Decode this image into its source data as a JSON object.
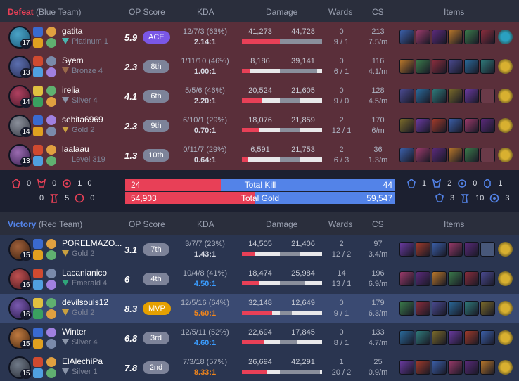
{
  "headers": {
    "op_score": "OP Score",
    "kda": "KDA",
    "damage": "Damage",
    "wards": "Wards",
    "cs": "CS",
    "items": "Items"
  },
  "blue_team": {
    "result": "Defeat",
    "label": "(Blue Team)",
    "result_color": "#e84057",
    "players": [
      {
        "name": "gatita",
        "rank": "Platinum 1",
        "level": "17",
        "op": "5.9",
        "badge": "ACE",
        "kda_detail": "12/7/3 (63%)",
        "kda_ratio": "2.14:1",
        "dmg_dealt": "41,273",
        "dmg_taken": "44,728",
        "dealt_frac": 0.92,
        "taken_frac": 1.0,
        "wards_placed": "0",
        "wards_detail": "9 / 1",
        "cs": "213",
        "cs_per_min": "7.5/m"
      },
      {
        "name": "Syem",
        "rank": "Bronze 4",
        "level": "13",
        "op": "2.3",
        "badge": "8th",
        "kda_detail": "1/11/10 (46%)",
        "kda_ratio": "1.00:1",
        "dmg_dealt": "8,186",
        "dmg_taken": "39,141",
        "dealt_frac": 0.18,
        "taken_frac": 0.88,
        "wards_placed": "0",
        "wards_detail": "6 / 1",
        "cs": "116",
        "cs_per_min": "4.1/m"
      },
      {
        "name": "irelia",
        "rank": "Silver 4",
        "level": "14",
        "op": "4.1",
        "badge": "6th",
        "kda_detail": "5/5/6 (46%)",
        "kda_ratio": "2.20:1",
        "dmg_dealt": "20,524",
        "dmg_taken": "21,605",
        "dealt_frac": 0.46,
        "taken_frac": 0.48,
        "wards_placed": "0",
        "wards_detail": "9 / 0",
        "cs": "128",
        "cs_per_min": "4.5/m"
      },
      {
        "name": "sebita6969",
        "rank": "Gold 2",
        "level": "14",
        "op": "2.3",
        "badge": "9th",
        "kda_detail": "6/10/1 (29%)",
        "kda_ratio": "0.70:1",
        "dmg_dealt": "18,076",
        "dmg_taken": "21,859",
        "dealt_frac": 0.4,
        "taken_frac": 0.49,
        "wards_placed": "2",
        "wards_detail": "12 / 1",
        "cs": "170",
        "cs_per_min": "6/m"
      },
      {
        "name": "laalaau",
        "rank": "Level 319",
        "level": "13",
        "op": "1.3",
        "badge": "10th",
        "kda_detail": "0/11/7 (29%)",
        "kda_ratio": "0.64:1",
        "dmg_dealt": "6,591",
        "dmg_taken": "21,753",
        "dealt_frac": 0.15,
        "taken_frac": 0.49,
        "wards_placed": "2",
        "wards_detail": "6 / 3",
        "cs": "36",
        "cs_per_min": "1.3/m"
      }
    ]
  },
  "red_team": {
    "result": "Victory",
    "label": "(Red Team)",
    "result_color": "#5383e8",
    "players": [
      {
        "name": "PORELMAZO...",
        "rank": "Gold 2",
        "level": "15",
        "op": "3.1",
        "badge": "7th",
        "kda_detail": "3/7/7 (23%)",
        "kda_ratio": "1.43:1",
        "dmg_dealt": "14,505",
        "dmg_taken": "21,406",
        "dealt_frac": 0.32,
        "taken_frac": 0.48,
        "wards_placed": "2",
        "wards_detail": "12 / 2",
        "cs": "97",
        "cs_per_min": "3.4/m"
      },
      {
        "name": "Lacanianico",
        "rank": "Emerald 4",
        "level": "16",
        "op": "6",
        "badge": "4th",
        "kda_detail": "10/4/8 (41%)",
        "kda_ratio": "4.50:1",
        "dmg_dealt": "18,474",
        "dmg_taken": "25,984",
        "dealt_frac": 0.41,
        "taken_frac": 0.58,
        "wards_placed": "14",
        "wards_detail": "13 / 1",
        "cs": "196",
        "cs_per_min": "6.9/m"
      },
      {
        "name": "devilsouls12",
        "rank": "Gold 2",
        "level": "16",
        "op": "8.3",
        "badge": "MVP",
        "kda_detail": "12/5/16 (64%)",
        "kda_ratio": "5.60:1",
        "dmg_dealt": "32,148",
        "dmg_taken": "12,649",
        "dealt_frac": 0.72,
        "taken_frac": 0.28,
        "wards_placed": "0",
        "wards_detail": "9 / 1",
        "cs": "179",
        "cs_per_min": "6.3/m"
      },
      {
        "name": "Winter",
        "rank": "Silver 4",
        "level": "15",
        "op": "6.8",
        "badge": "3rd",
        "kda_detail": "12/5/11 (52%)",
        "kda_ratio": "4.60:1",
        "dmg_dealt": "22,694",
        "dmg_taken": "17,845",
        "dealt_frac": 0.51,
        "taken_frac": 0.4,
        "wards_placed": "0",
        "wards_detail": "8 / 1",
        "cs": "133",
        "cs_per_min": "4.7/m"
      },
      {
        "name": "ElAlechiPa",
        "rank": "Silver 1",
        "level": "15",
        "op": "7.8",
        "badge": "2nd",
        "kda_detail": "7/3/18 (57%)",
        "kda_ratio": "8.33:1",
        "dmg_dealt": "26,694",
        "dmg_taken": "42,291",
        "dealt_frac": 0.6,
        "taken_frac": 0.95,
        "wards_placed": "1",
        "wards_detail": "20 / 2",
        "cs": "25",
        "cs_per_min": "0.9/m"
      }
    ]
  },
  "summary": {
    "total_kill_label": "Total Kill",
    "total_gold_label": "Total Gold",
    "kills_left": "24",
    "kills_right": "44",
    "kills_left_frac": 0.353,
    "gold_left": "54,903",
    "gold_right": "59,547",
    "gold_left_frac": 0.48,
    "left_objectives": {
      "top": [
        "0",
        "0",
        "1",
        "0"
      ],
      "bottom": [
        "0",
        "5",
        "0"
      ]
    },
    "right_objectives": {
      "top": [
        "1",
        "2",
        "0",
        "1"
      ],
      "bottom": [
        "3",
        "10",
        "3"
      ]
    }
  },
  "colors": {
    "loss_bg": "#5a2f3a",
    "win_bg": "#2a3550",
    "highlight_bg": "#3a4a72",
    "red": "#e84057",
    "blue": "#5383e8",
    "ace_badge": "#7a57e6",
    "mvp_badge": "#e5a000"
  }
}
